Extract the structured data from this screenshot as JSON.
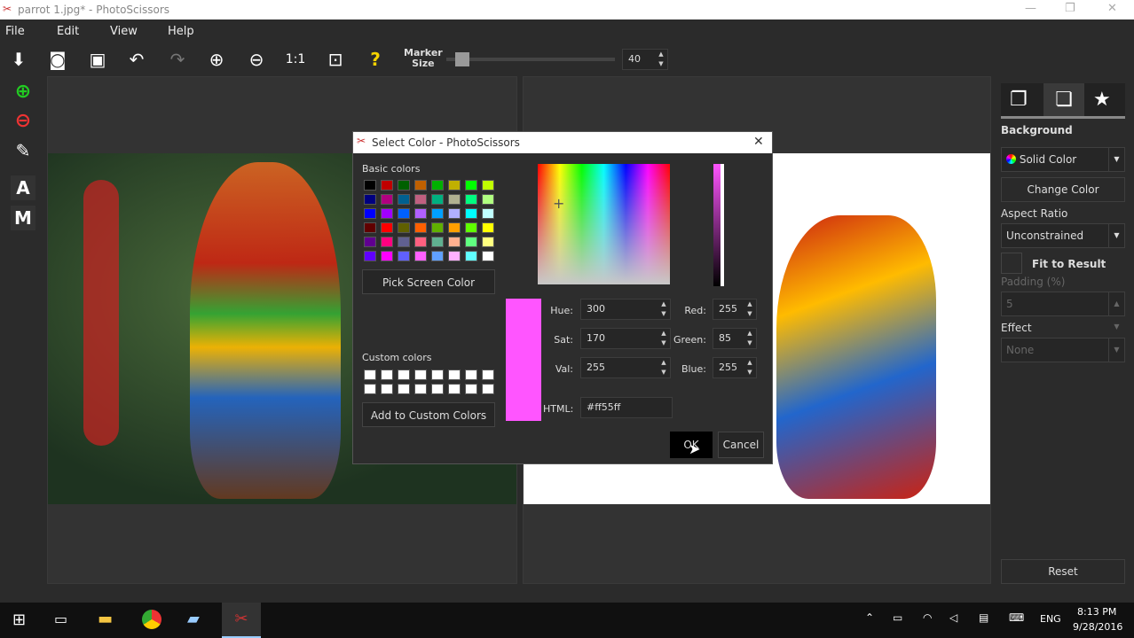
{
  "window": {
    "title": "parrot 1.jpg* - PhotoScissors",
    "minimize": "—",
    "maximize": "❐",
    "close": "✕"
  },
  "menu": [
    "File",
    "Edit",
    "View",
    "Help"
  ],
  "toolbar": {
    "marker_label_1": "Marker",
    "marker_label_2": "Size",
    "marker_value": "40",
    "marker_fraction": 0.05,
    "help": "?"
  },
  "tools": {
    "text": "A",
    "mask": "M"
  },
  "right_panel": {
    "section": "Background",
    "background_type": "Solid Color",
    "change_color": "Change Color",
    "aspect_label": "Aspect Ratio",
    "aspect_value": "Unconstrained",
    "fit_label": "Fit to Result",
    "padding_label": "Padding (%)",
    "padding_value": "5",
    "effect_label": "Effect",
    "effect_value": "None",
    "reset": "Reset"
  },
  "dialog": {
    "title": "Select Color - PhotoScissors",
    "close": "✕",
    "basic_label": "Basic colors",
    "basic_colors": [
      "#000000",
      "#c00000",
      "#006000",
      "#c06000",
      "#00b000",
      "#c0b000",
      "#00ff00",
      "#c0ff00",
      "#000080",
      "#b00080",
      "#006090",
      "#c06080",
      "#00b080",
      "#b0b090",
      "#00ff80",
      "#b0ff80",
      "#0000ff",
      "#a000ff",
      "#0060ff",
      "#b060ff",
      "#00a0ff",
      "#b0b0ff",
      "#00ffff",
      "#c0ffff",
      "#600000",
      "#ff0000",
      "#606000",
      "#ff6000",
      "#60b000",
      "#ffa000",
      "#60ff00",
      "#ffff00",
      "#600090",
      "#ff0080",
      "#606090",
      "#ff6080",
      "#60b090",
      "#ffb090",
      "#60ff80",
      "#ffff80",
      "#6000ff",
      "#ff00ff",
      "#6060ff",
      "#ff60ff",
      "#60a0ff",
      "#ffb0ff",
      "#60ffff",
      "#ffffff"
    ],
    "pick_screen": "Pick Screen Color",
    "custom_label": "Custom colors",
    "add_custom": "Add to Custom Colors",
    "hue_label": "Hue:",
    "hue": "300",
    "sat_label": "Sat:",
    "sat": "170",
    "val_label": "Val:",
    "val": "255",
    "red_label": "Red:",
    "red": "255",
    "green_label": "Green:",
    "green": "85",
    "blue_label": "Blue:",
    "blue": "255",
    "html_label": "HTML:",
    "html": "#ff55ff",
    "current_color": "#ff55ff",
    "ok": "OK",
    "cancel": "Cancel"
  },
  "taskbar": {
    "lang": "ENG",
    "time": "8:13 PM",
    "date": "9/28/2016"
  }
}
